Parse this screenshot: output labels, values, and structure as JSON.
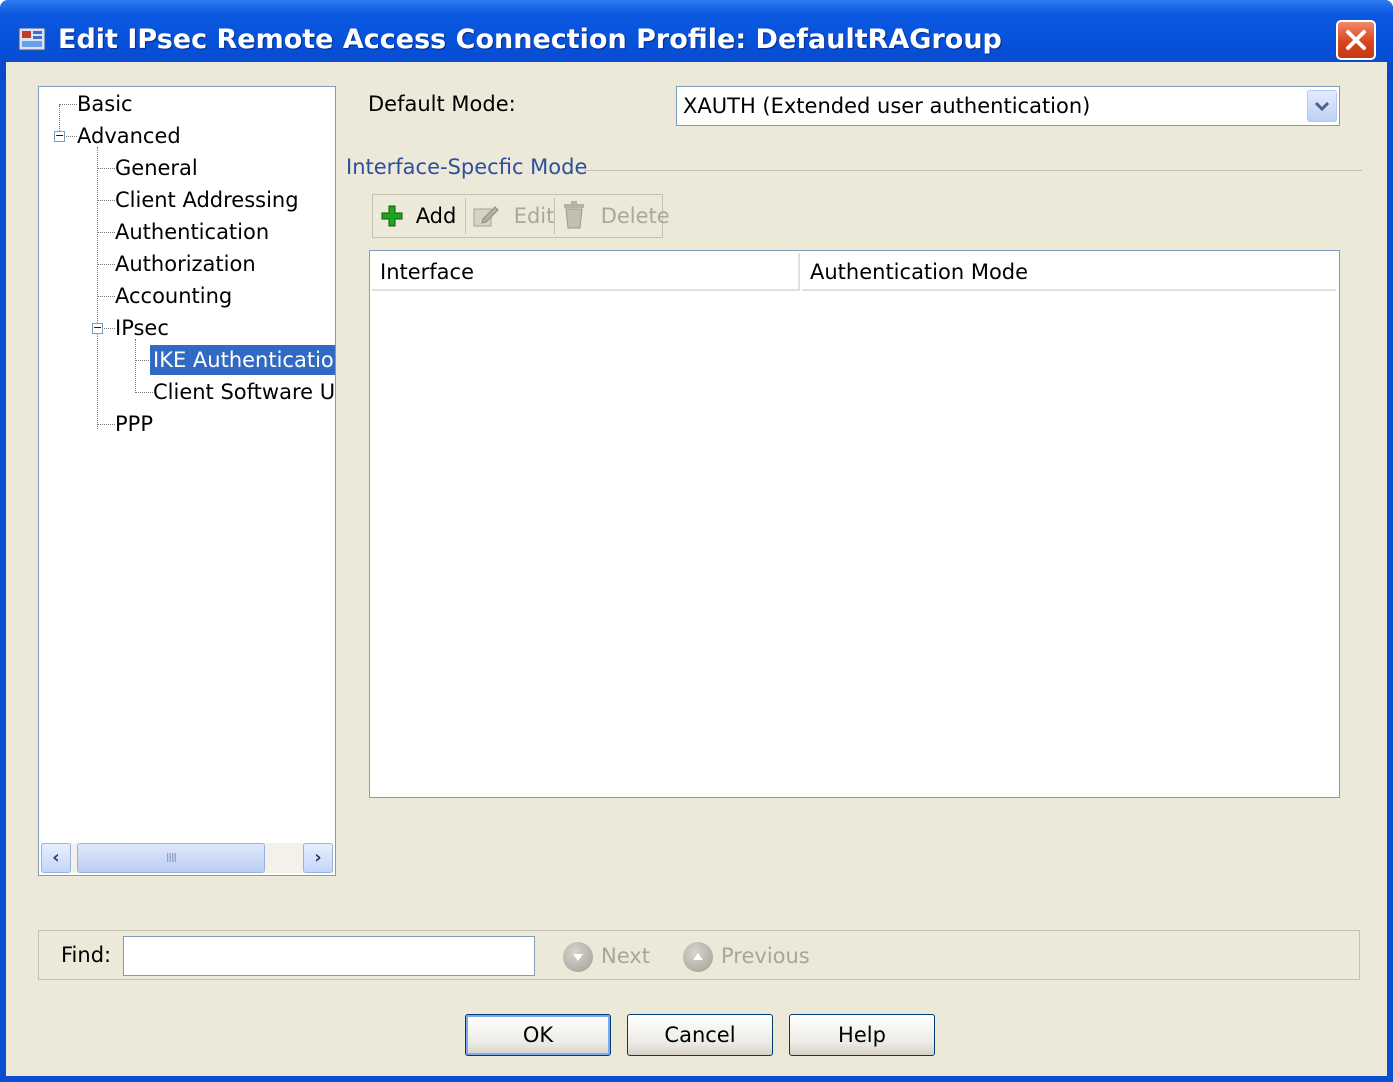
{
  "window": {
    "title": "Edit IPsec Remote Access Connection Profile: DefaultRAGroup"
  },
  "tree": {
    "items": [
      {
        "label": "Basic"
      },
      {
        "label": "Advanced"
      },
      {
        "label": "General"
      },
      {
        "label": "Client Addressing"
      },
      {
        "label": "Authentication"
      },
      {
        "label": "Authorization"
      },
      {
        "label": "Accounting"
      },
      {
        "label": "IPsec"
      },
      {
        "label": "IKE Authentication",
        "selected": true
      },
      {
        "label": "Client Software Upgrade"
      },
      {
        "label": "PPP"
      }
    ],
    "scroll_thumb_grip": "IIII"
  },
  "default_mode": {
    "label": "Default Mode:",
    "value": "XAUTH (Extended user authentication)"
  },
  "interface_specific": {
    "group_title": "Interface-Specfic Mode",
    "toolbar": {
      "add_label": "Add",
      "edit_label": "Edit",
      "delete_label": "Delete"
    },
    "table": {
      "columns": [
        "Interface",
        "Authentication Mode"
      ],
      "rows": []
    }
  },
  "find": {
    "label": "Find:",
    "value": "",
    "next_label": "Next",
    "previous_label": "Previous"
  },
  "buttons": {
    "ok": "OK",
    "cancel": "Cancel",
    "help": "Help"
  },
  "colors": {
    "titlebar": "#0a55dd",
    "dialog_bg": "#ece9d8",
    "selection": "#316ac5",
    "group_title": "#2e4ea0",
    "add_icon": "#1fa61f",
    "close_button": "#d9451d"
  }
}
